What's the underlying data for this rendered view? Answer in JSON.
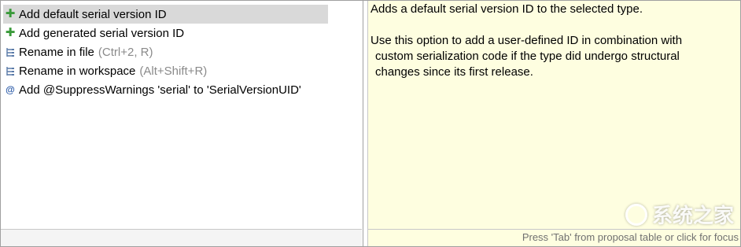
{
  "proposals": {
    "items": [
      {
        "icon": "plus-icon",
        "label": "Add default serial version ID",
        "shortcut": "",
        "selected": true
      },
      {
        "icon": "plus-icon",
        "label": "Add generated serial version ID",
        "shortcut": ""
      },
      {
        "icon": "rename-icon",
        "label": "Rename in file",
        "shortcut": "(Ctrl+2, R)"
      },
      {
        "icon": "rename-icon",
        "label": "Rename in workspace",
        "shortcut": "(Alt+Shift+R)"
      },
      {
        "icon": "annotation-icon",
        "label": "Add @SuppressWarnings 'serial' to 'SerialVersionUID'",
        "shortcut": ""
      }
    ]
  },
  "info": {
    "line1": "Adds a default serial version ID to the selected type.",
    "line2": "Use this option to add a user-defined ID in combination with",
    "line3": "custom serialization code if the type did undergo structural",
    "line4": "changes since its first release.",
    "status": "Press 'Tab' from proposal table or click for focus"
  },
  "watermark": {
    "text": "系统之家"
  },
  "colors": {
    "info_bg": "#fefee0",
    "selection": "#d9d9d9",
    "plus": "#3a9a3a"
  }
}
